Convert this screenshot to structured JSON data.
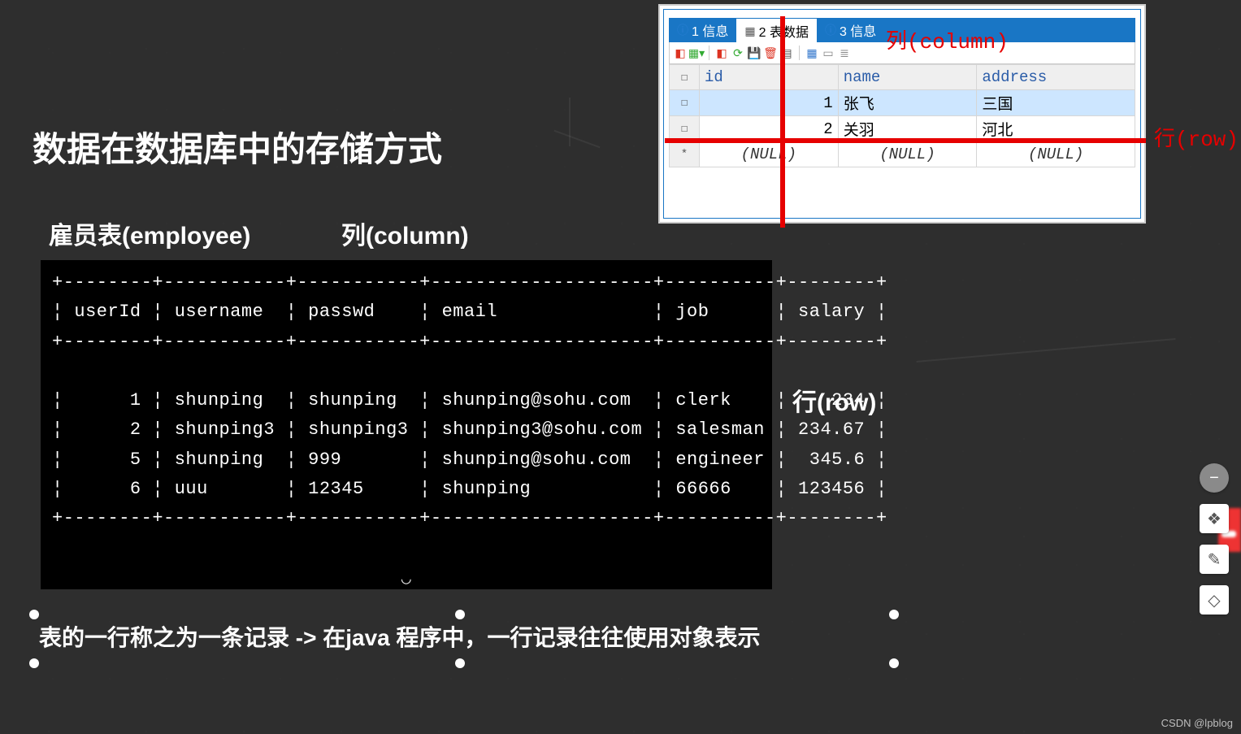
{
  "slide": {
    "title": "数据在数据库中的存储方式",
    "table_label": "雇员表(employee)",
    "column_label": "列(column)",
    "row_label": "行(row)",
    "caption": "表的一行称之为一条记录 -> 在java 程序中，一行记录往往使用对象表示"
  },
  "terminal": {
    "headers": [
      "userId",
      "username",
      "passwd",
      "email",
      "job",
      "salary"
    ],
    "rows": [
      {
        "userId": "1",
        "username": "shunping",
        "passwd": "shunping",
        "email": "shunping@sohu.com",
        "job": "clerk",
        "salary": "234"
      },
      {
        "userId": "2",
        "username": "shunping3",
        "passwd": "shunping3",
        "email": "shunping3@sohu.com",
        "job": "salesman",
        "salary": "234.67"
      },
      {
        "userId": "5",
        "username": "shunping",
        "passwd": "999",
        "email": "shunping@sohu.com",
        "job": "engineer",
        "salary": "345.6"
      },
      {
        "userId": "6",
        "username": "uuu",
        "passwd": "12345",
        "email": "shunping",
        "job": "66666",
        "salary": "123456"
      }
    ]
  },
  "dbtool": {
    "tabs": {
      "info1": "1 信息",
      "data": "2 表数据",
      "info3": "3 信息"
    },
    "annotations": {
      "column": "列(column)",
      "row": "行(row)"
    },
    "grid": {
      "headers": [
        "id",
        "name",
        "address"
      ],
      "rows": [
        {
          "id": "1",
          "name": "张飞",
          "address": "三国"
        },
        {
          "id": "2",
          "name": "关羽",
          "address": "河北"
        }
      ],
      "null_placeholder": "(NULL)"
    }
  },
  "watermark": "CSDN @lpblog"
}
